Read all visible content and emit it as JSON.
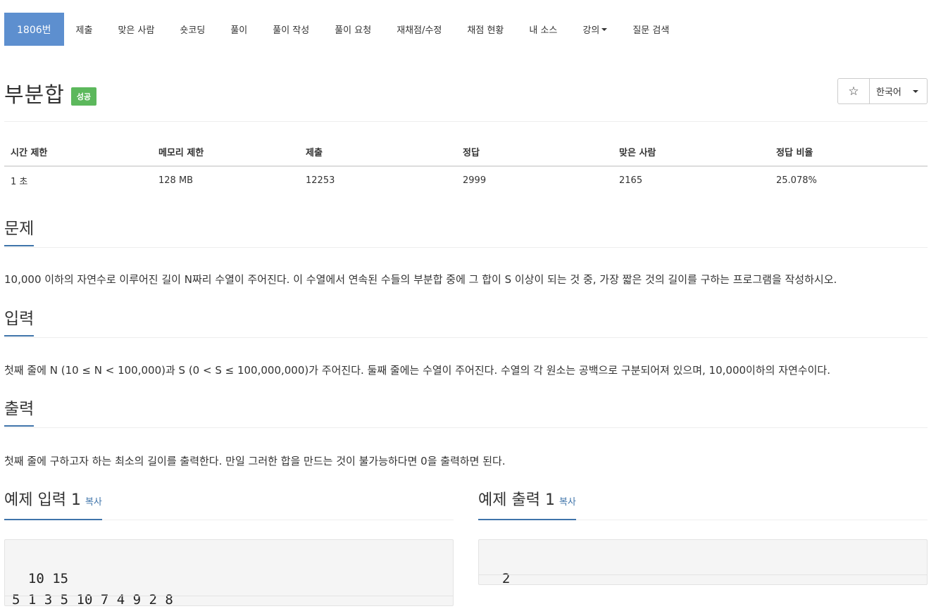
{
  "nav": {
    "items": [
      {
        "label": "1806번"
      },
      {
        "label": "제출"
      },
      {
        "label": "맞은 사람"
      },
      {
        "label": "숏코딩"
      },
      {
        "label": "풀이"
      },
      {
        "label": "풀이 작성"
      },
      {
        "label": "풀이 요청"
      },
      {
        "label": "재채점/수정"
      },
      {
        "label": "채점 현황"
      },
      {
        "label": "내 소스"
      },
      {
        "label": "강의"
      },
      {
        "label": "질문 검색"
      }
    ]
  },
  "problem": {
    "title": "부분합",
    "badge": "성공",
    "star": "☆",
    "language": "한국어"
  },
  "stats": {
    "headers": [
      "시간 제한",
      "메모리 제한",
      "제출",
      "정답",
      "맞은 사람",
      "정답 비율"
    ],
    "values": [
      "1 초",
      "128 MB",
      "12253",
      "2999",
      "2165",
      "25.078%"
    ]
  },
  "sections": {
    "problem_title": "문제",
    "problem_text": "10,000 이하의 자연수로 이루어진 길이 N짜리 수열이 주어진다. 이 수열에서 연속된 수들의 부분합 중에 그 합이 S 이상이 되는 것 중, 가장 짧은 것의 길이를 구하는 프로그램을 작성하시오.",
    "input_title": "입력",
    "input_text": "첫째 줄에 N (10 ≤ N < 100,000)과 S (0 < S ≤ 100,000,000)가 주어진다. 둘째 줄에는 수열이 주어진다. 수열의 각 원소는 공백으로 구분되어져 있으며, 10,000이하의 자연수이다.",
    "output_title": "출력",
    "output_text": "첫째 줄에 구하고자 하는 최소의 길이를 출력한다. 만일 그러한 합을 만드는 것이 불가능하다면 0을 출력하면 된다."
  },
  "samples": {
    "input_title": "예제 입력 1",
    "output_title": "예제 출력 1",
    "copy_label": "복사",
    "input_body": "10 15\n5 1 3 5 10 7 4 9 2 8",
    "output_body": "2"
  }
}
